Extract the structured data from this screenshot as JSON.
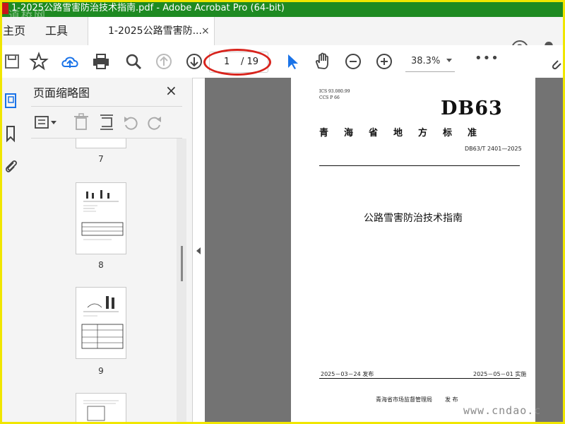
{
  "window": {
    "title": "1-2025公路雪害防治技术指南.pdf - Adobe Acrobat Pro (64-bit)",
    "watermark": "道桥网"
  },
  "tabs": {
    "home": "主页",
    "tools": "工具",
    "document": "1-2025公路雪害防...",
    "close": "×"
  },
  "toolbar": {
    "current_page": "1",
    "total_pages": "/ 19",
    "zoom": "38.3%",
    "more": "•••"
  },
  "panel": {
    "title": "页面缩略图",
    "close": "×",
    "thumb_labels": [
      "7",
      "8",
      "9"
    ]
  },
  "document": {
    "ics": "ICS  93.080.99",
    "ccs": "CCS  P 66",
    "code": "DB63",
    "province": "青海省地方标准",
    "standard_no": "DB63/T 2401—2025",
    "title": "公路雪害防治技术指南",
    "issue_date": "2025－03－24 发布",
    "implement_date": "2025－05－01 实施",
    "publisher": "青海省市场监督管理局",
    "publish_word": "发 布"
  },
  "site_watermark": "www.cndao.c",
  "colors": {
    "titlebar": "#1e8a22",
    "accent": "#1a73e8",
    "annotation": "#d8231c"
  }
}
